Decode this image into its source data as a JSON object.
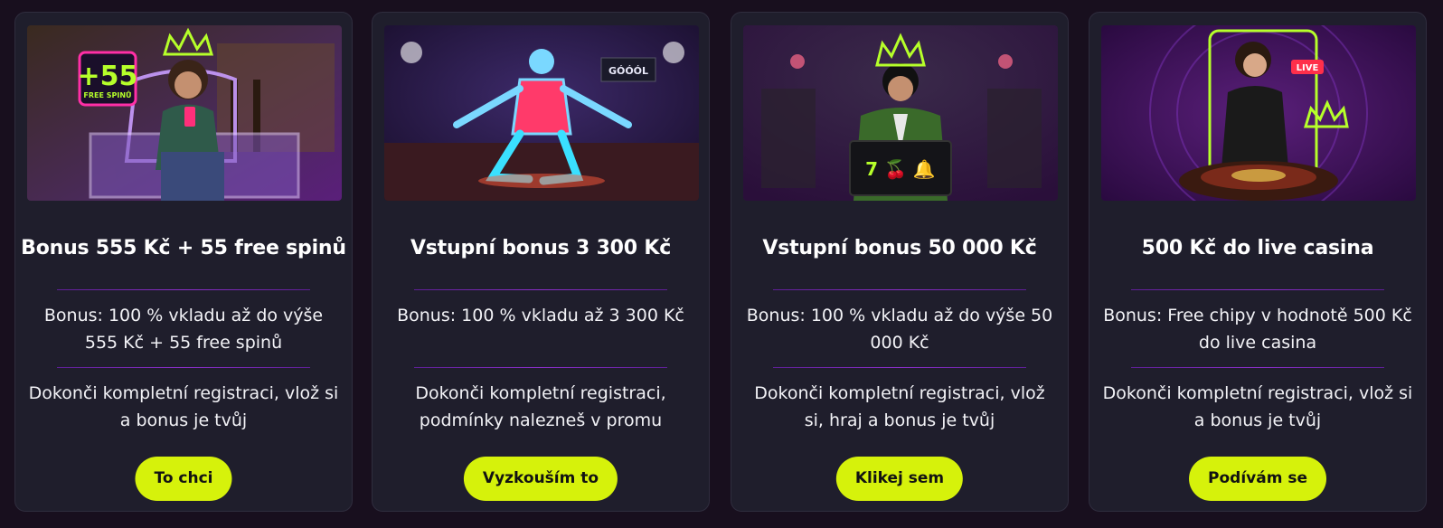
{
  "offers": [
    {
      "title": "Bonus 555 Kč + 55 free spinů",
      "bonus": "Bonus: 100 % vkladu až do výše 555 Kč + 55 free spinů",
      "condition": "Dokonči kompletní registraci, vlož si a bonus je tvůj",
      "button": "To chci",
      "badge_number": "+55",
      "badge_text": "FREE SPINŮ"
    },
    {
      "title": "Vstupní bonus 3 300 Kč",
      "bonus": "Bonus: 100 % vkladu až 3 300 Kč",
      "condition": "Dokonči kompletní registraci, podmínky nalezneš v promu",
      "button": "Vyzkouším to",
      "screen_text": "GÓÓÓL"
    },
    {
      "title": "Vstupní bonus 50 000 Kč",
      "bonus": "Bonus: 100 % vkladu až do výše 50 000 Kč",
      "condition": "Dokonči kompletní registraci, vlož si, hraj a bonus je tvůj",
      "button": "Klikej sem",
      "case_symbols": "7 🍒 🔔"
    },
    {
      "title": "500 Kč do live casina",
      "bonus": "Bonus: Free chipy v hodnotě 500 Kč do live casina",
      "condition": "Dokonči kompletní registraci, vlož si a bonus je tvůj",
      "button": "Podívám se",
      "live_badge": "LIVE"
    }
  ],
  "colors": {
    "background": "#180f1e",
    "card": "#1f1e2c",
    "button": "#d6f20b",
    "divider": "#8a2fc9",
    "neon_green": "#b6ff2a",
    "neon_pink": "#ff2fa6"
  },
  "icons": [
    "crown-icon",
    "slot-symbols-icon",
    "roulette-icon"
  ]
}
